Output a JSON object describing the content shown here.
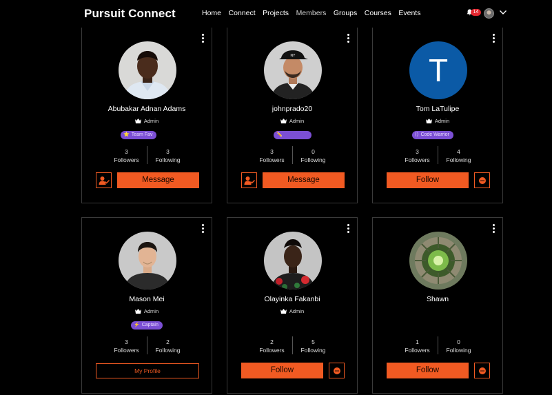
{
  "header": {
    "brand": "Pursuit Connect",
    "nav": [
      "Home",
      "Connect",
      "Projects",
      "Members",
      "Groups",
      "Courses",
      "Events"
    ],
    "active_nav": "Members",
    "notifications_count": "14"
  },
  "colors": {
    "accent": "#f15a22",
    "badge": "#7b4fd4",
    "letter_avatar": "#0b5aa6",
    "notification": "#e3262f"
  },
  "members": [
    {
      "name": "Abubakar Adnan Adams",
      "role": "Admin",
      "badge": "Team Fav",
      "badge_icon": "star-icon",
      "followers": "3",
      "followers_label": "Followers",
      "following": "3",
      "following_label": "Following",
      "action": "Message"
    },
    {
      "name": "johnprado20",
      "role": "Admin",
      "badge": "",
      "badge_icon": "pencil-icon",
      "followers": "3",
      "followers_label": "Followers",
      "following": "0",
      "following_label": "Following",
      "action": "Message"
    },
    {
      "name": "Tom LaTulipe",
      "role": "Admin",
      "avatar_letter": "T",
      "badge": "Code Warrior",
      "badge_icon": "code-icon",
      "followers": "3",
      "followers_label": "Followers",
      "following": "4",
      "following_label": "Following",
      "action": "Follow"
    },
    {
      "name": "Mason Mei",
      "role": "Admin",
      "badge": "Captain",
      "badge_icon": "bolt-icon",
      "followers": "3",
      "followers_label": "Followers",
      "following": "2",
      "following_label": "Following",
      "action": "My Profile"
    },
    {
      "name": "Olayinka Fakanbi",
      "role": "Admin",
      "followers": "2",
      "followers_label": "Followers",
      "following": "5",
      "following_label": "Following",
      "action": "Follow"
    },
    {
      "name": "Shawn",
      "followers": "1",
      "followers_label": "Followers",
      "following": "0",
      "following_label": "Following",
      "action": "Follow"
    }
  ]
}
